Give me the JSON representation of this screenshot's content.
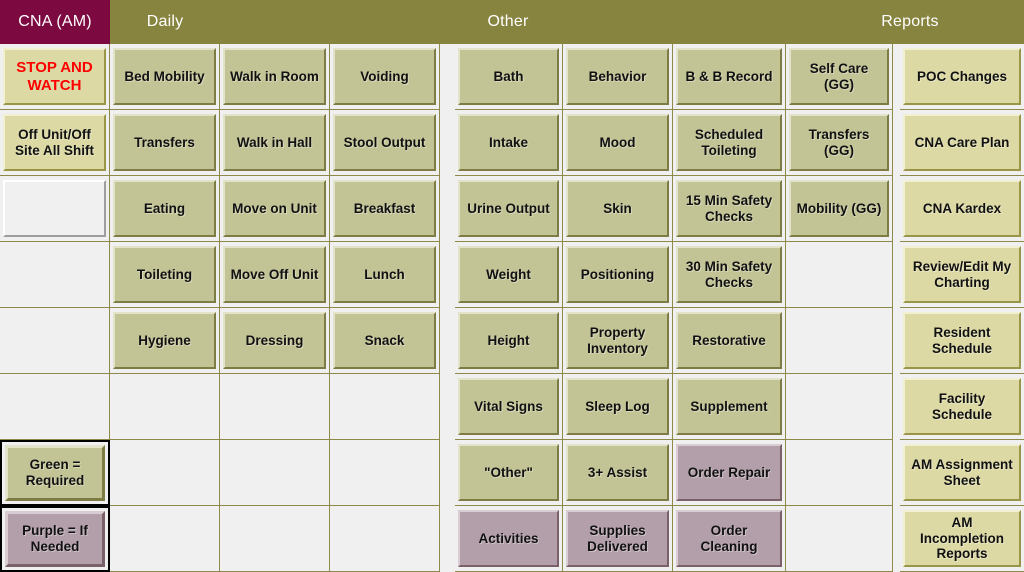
{
  "header": {
    "sections": [
      {
        "label": "CNA (AM)",
        "name": "header-cna"
      },
      {
        "label": "Daily",
        "name": "header-daily"
      },
      {
        "label": "Other",
        "name": "header-other"
      },
      {
        "label": "Reports",
        "name": "header-reports"
      }
    ]
  },
  "colors": {
    "header_bar": "#87843f",
    "header_cna": "#7c0a41",
    "green_required": "#c3c496",
    "purple_if_needed": "#b39fa9",
    "reports_khaki": "#dcd9a4",
    "grid_line": "#8d8a4a",
    "empty_cell": "#f0f0f0",
    "stop_and_watch_text": "#ff0000"
  },
  "columns": [
    {
      "name": "column-cna",
      "group": "left",
      "cells": [
        {
          "label": "STOP AND WATCH",
          "style": "stopwatch"
        },
        {
          "label": "Off Unit/Off Site All Shift",
          "style": "khaki"
        },
        {
          "label": "",
          "style": "blank"
        },
        {
          "label": "",
          "style": "empty"
        },
        {
          "label": "",
          "style": "empty"
        },
        {
          "label": "",
          "style": "empty"
        },
        {
          "label": "Green = Required",
          "style": "legend-green"
        },
        {
          "label": "Purple  = If Needed",
          "style": "legend-purple"
        }
      ]
    },
    {
      "name": "column-daily-1",
      "group": "left",
      "cells": [
        {
          "label": "Bed Mobility",
          "style": "green"
        },
        {
          "label": "Transfers",
          "style": "green"
        },
        {
          "label": "Eating",
          "style": "green"
        },
        {
          "label": "Toileting",
          "style": "green"
        },
        {
          "label": "Hygiene",
          "style": "green"
        },
        {
          "label": "",
          "style": "empty"
        },
        {
          "label": "",
          "style": "empty"
        },
        {
          "label": "",
          "style": "empty"
        }
      ]
    },
    {
      "name": "column-daily-2",
      "group": "left",
      "cells": [
        {
          "label": "Walk in Room",
          "style": "green"
        },
        {
          "label": "Walk in Hall",
          "style": "green"
        },
        {
          "label": "Move on Unit",
          "style": "green"
        },
        {
          "label": "Move Off Unit",
          "style": "green"
        },
        {
          "label": "Dressing",
          "style": "green"
        },
        {
          "label": "",
          "style": "empty"
        },
        {
          "label": "",
          "style": "empty"
        },
        {
          "label": "",
          "style": "empty"
        }
      ]
    },
    {
      "name": "column-daily-3",
      "group": "left",
      "cells": [
        {
          "label": "Voiding",
          "style": "green"
        },
        {
          "label": "Stool Output",
          "style": "green"
        },
        {
          "label": "Breakfast",
          "style": "green"
        },
        {
          "label": "Lunch",
          "style": "green"
        },
        {
          "label": "Snack",
          "style": "green"
        },
        {
          "label": "",
          "style": "empty"
        },
        {
          "label": "",
          "style": "empty"
        },
        {
          "label": "",
          "style": "empty"
        }
      ]
    },
    {
      "name": "column-other-1",
      "group": "mid",
      "cells": [
        {
          "label": "Bath",
          "style": "green"
        },
        {
          "label": "Intake",
          "style": "green"
        },
        {
          "label": "Urine Output",
          "style": "green"
        },
        {
          "label": "Weight",
          "style": "green"
        },
        {
          "label": "Height",
          "style": "green"
        },
        {
          "label": "Vital Signs",
          "style": "green"
        },
        {
          "label": "\"Other\"",
          "style": "green"
        },
        {
          "label": "Activities",
          "style": "purple"
        }
      ]
    },
    {
      "name": "column-other-2",
      "group": "mid",
      "cells": [
        {
          "label": "Behavior",
          "style": "green"
        },
        {
          "label": "Mood",
          "style": "green"
        },
        {
          "label": "Skin",
          "style": "green"
        },
        {
          "label": "Positioning",
          "style": "green"
        },
        {
          "label": "Property Inventory",
          "style": "green"
        },
        {
          "label": "Sleep Log",
          "style": "green"
        },
        {
          "label": "3+ Assist",
          "style": "green"
        },
        {
          "label": "Supplies Delivered",
          "style": "purple"
        }
      ]
    },
    {
      "name": "column-other-3",
      "group": "mid",
      "cells": [
        {
          "label": "B & B Record",
          "style": "green"
        },
        {
          "label": "Scheduled Toileting",
          "style": "green"
        },
        {
          "label": "15 Min Safety Checks",
          "style": "green"
        },
        {
          "label": "30 Min Safety Checks",
          "style": "green"
        },
        {
          "label": "Restorative",
          "style": "green"
        },
        {
          "label": "Supplement",
          "style": "green"
        },
        {
          "label": "Order Repair",
          "style": "purple"
        },
        {
          "label": "Order Cleaning",
          "style": "purple"
        }
      ]
    },
    {
      "name": "column-other-4",
      "group": "mid",
      "cells": [
        {
          "label": "Self Care (GG)",
          "style": "green"
        },
        {
          "label": "Transfers (GG)",
          "style": "green"
        },
        {
          "label": "Mobility (GG)",
          "style": "green"
        },
        {
          "label": "",
          "style": "empty"
        },
        {
          "label": "",
          "style": "empty"
        },
        {
          "label": "",
          "style": "empty"
        },
        {
          "label": "",
          "style": "empty"
        },
        {
          "label": "",
          "style": "empty"
        }
      ]
    },
    {
      "name": "column-reports",
      "group": "right",
      "cells": [
        {
          "label": "POC Changes",
          "style": "khaki"
        },
        {
          "label": "CNA Care Plan",
          "style": "khaki"
        },
        {
          "label": "CNA Kardex",
          "style": "khaki"
        },
        {
          "label": "Review/Edit My Charting",
          "style": "khaki"
        },
        {
          "label": "Resident Schedule",
          "style": "khaki"
        },
        {
          "label": "Facility Schedule",
          "style": "khaki"
        },
        {
          "label": "AM Assignment Sheet",
          "style": "khaki"
        },
        {
          "label": "AM Incompletion Reports",
          "style": "khaki"
        }
      ]
    }
  ]
}
